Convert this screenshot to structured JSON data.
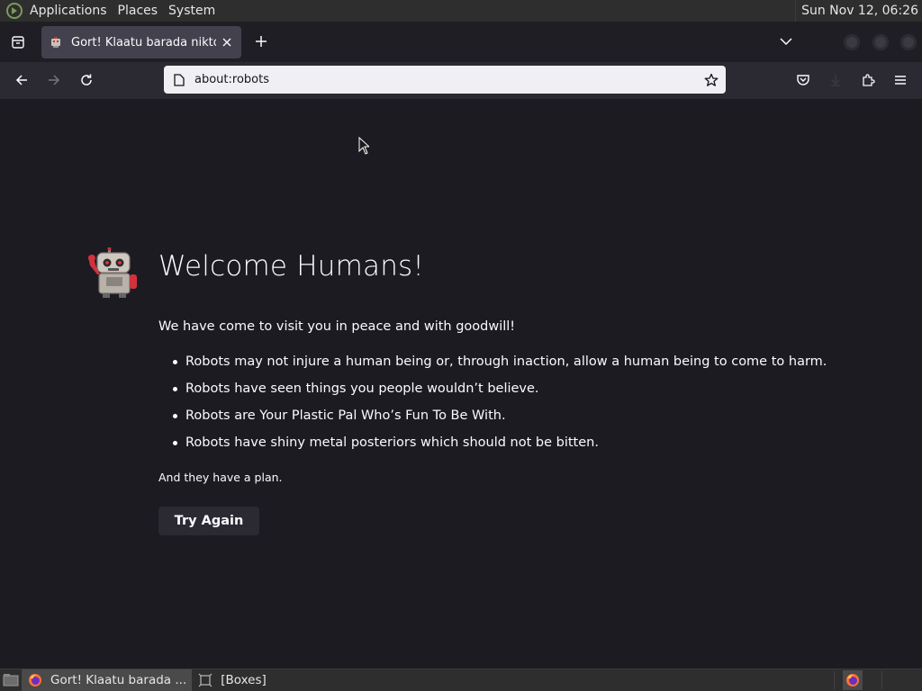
{
  "system_panel": {
    "menus": [
      "Applications",
      "Places",
      "System"
    ],
    "clock": "Sun Nov 12, 06:26"
  },
  "browser": {
    "tab": {
      "title": "Gort! Klaatu barada nikto!",
      "favicon": "robot-icon"
    },
    "url": "about:robots"
  },
  "page": {
    "heading": "Welcome Humans!",
    "intro": "We have come to visit you in peace and with goodwill!",
    "laws": [
      "Robots may not injure a human being or, through inaction, allow a human being to come to harm.",
      "Robots have seen things you people wouldn’t believe.",
      "Robots are Your Plastic Pal Who’s Fun To Be With.",
      "Robots have shiny metal posteriors which should not be bitten."
    ],
    "plan": "And they have a plan.",
    "button": "Try Again"
  },
  "taskbar": {
    "tasks": [
      {
        "label": "Gort! Klaatu barada ...",
        "icon": "firefox-icon",
        "active": true
      },
      {
        "label": "[Boxes]",
        "icon": "boxes-icon",
        "active": false
      }
    ]
  },
  "colors": {
    "content_bg": "#1c1b22",
    "toolbar_bg": "#2b2a33",
    "tab_active": "#42414d",
    "urlbar_bg": "#f0f0f4"
  }
}
